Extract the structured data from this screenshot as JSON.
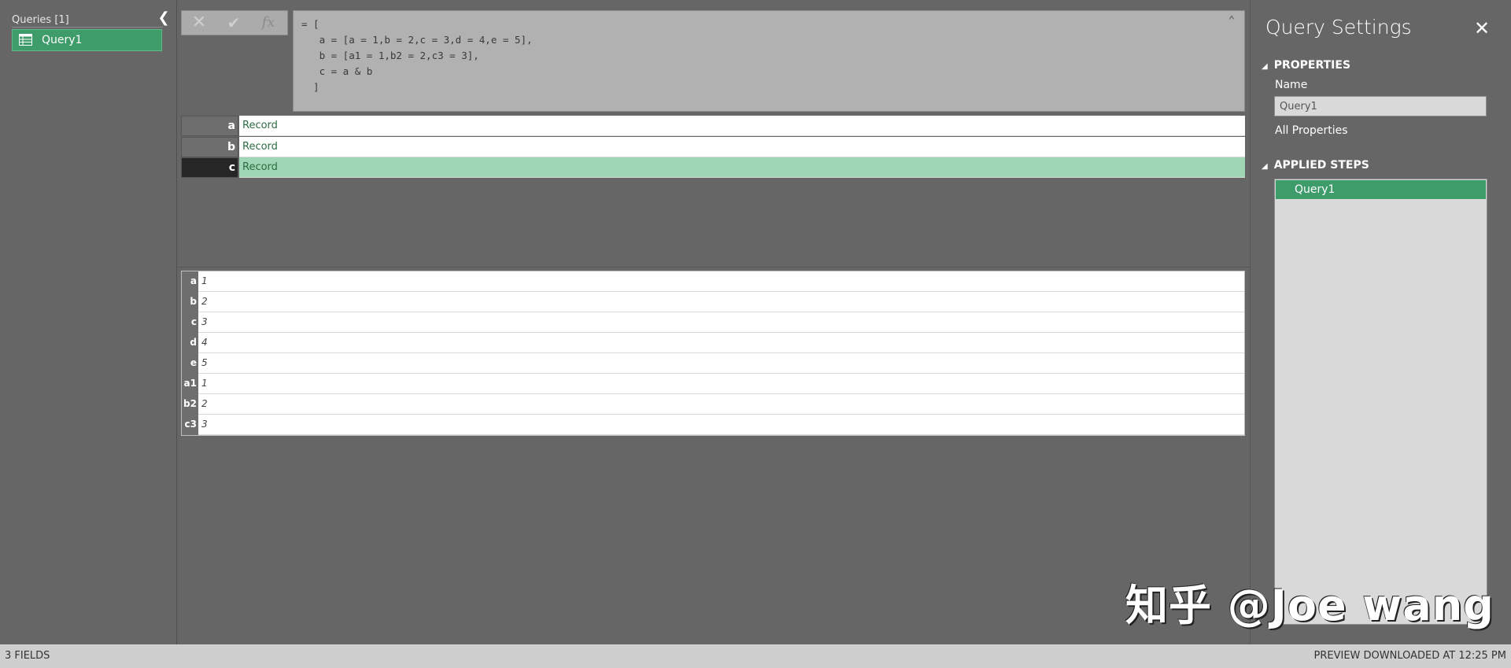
{
  "queries_pane": {
    "header": "Queries [1]",
    "collapse_icon": "chevron-left-icon",
    "items": [
      {
        "label": "Query1",
        "icon": "table-icon",
        "selected": true
      }
    ]
  },
  "formula_bar": {
    "cancel_icon": "close-icon",
    "commit_icon": "check-icon",
    "fx_label": "fx",
    "formula": "= [\n   a = [a = 1,b = 2,c = 3,d = 4,e = 5],\n   b = [a1 = 1,b2 = 2,c3 = 3],\n   c = a & b\n  ]",
    "expand_icon": "chevron-up-icon"
  },
  "record_preview": {
    "rows": [
      {
        "key": "a",
        "value": "Record",
        "selected": false
      },
      {
        "key": "b",
        "value": "Record",
        "selected": false
      },
      {
        "key": "c",
        "value": "Record",
        "selected": true
      }
    ]
  },
  "field_preview": {
    "rows": [
      {
        "key": "a",
        "value": "1"
      },
      {
        "key": "b",
        "value": "2"
      },
      {
        "key": "c",
        "value": "3"
      },
      {
        "key": "d",
        "value": "4"
      },
      {
        "key": "e",
        "value": "5"
      },
      {
        "key": "a1",
        "value": "1"
      },
      {
        "key": "b2",
        "value": "2"
      },
      {
        "key": "c3",
        "value": "3"
      }
    ]
  },
  "settings_pane": {
    "title": "Query Settings",
    "close_icon": "close-icon",
    "properties_heading": "PROPERTIES",
    "name_label": "Name",
    "name_value": "Query1",
    "all_properties": "All Properties",
    "applied_steps_heading": "APPLIED STEPS",
    "steps": [
      {
        "label": "Query1",
        "selected": true
      }
    ]
  },
  "watermark": "知乎 @Joe wang",
  "status_bar": {
    "left": "3 FIELDS",
    "right": "PREVIEW DOWNLOADED AT 12:25 PM"
  },
  "colors": {
    "accent_green": "#3e9b6a",
    "selected_row": "#9fd6b4",
    "pane_bg": "#666666"
  }
}
